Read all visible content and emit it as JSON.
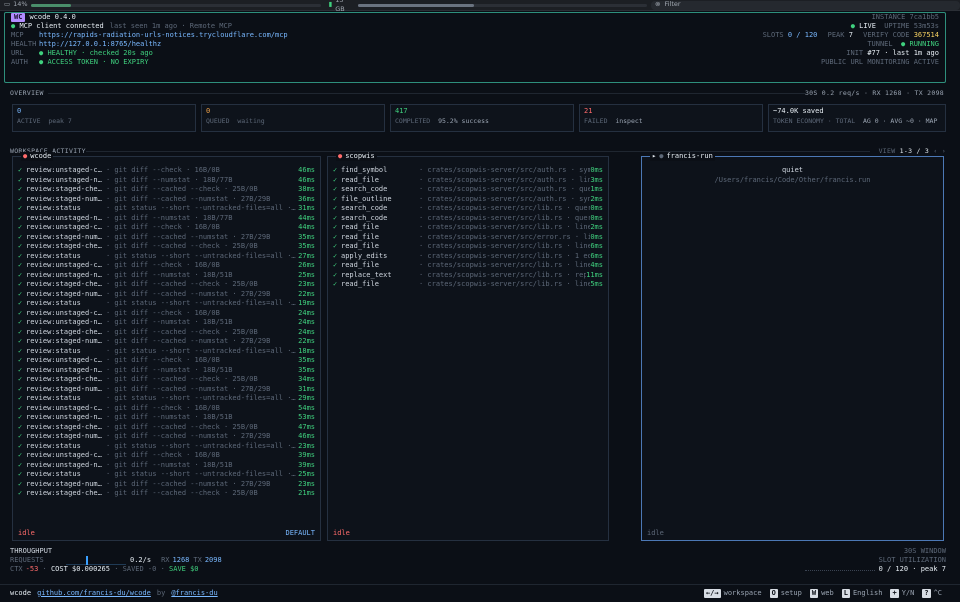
{
  "sysbar": {
    "cpu": "14%",
    "cpu_fraction": 0.14,
    "mem": "15 GB",
    "mem_fraction": 0.4,
    "filter_placeholder": "Filter"
  },
  "header": {
    "badge": "WC",
    "title": "wcode 0.4.0",
    "instance": "INSTANCE 7ca1bb5",
    "client_status": "MCP client connected",
    "last_seen": "last seen 1m ago · Remote MCP",
    "live": "LIVE",
    "uptime": "UPTIME 53m53s",
    "mcp_label": "MCP",
    "mcp_url": "https://rapids-radiation-urls-notices.trycloudflare.com/mcp",
    "slots_label": "SLOTS",
    "slots": "0 / 120",
    "peak_label": "PEAK",
    "peak": "7",
    "verify_label": "VERIFY CODE",
    "verify": "367514",
    "health_label": "HEALTH",
    "health_url": "http://127.0.0.1:8765/healthz",
    "tunnel_label": "TUNNEL",
    "tunnel_status": "RUNNING",
    "url_label": "URL",
    "url_status": "HEALTHY · checked 20s ago",
    "init_label": "INIT",
    "init": "#77 · last 1m ago",
    "auth_label": "AUTH",
    "auth_status": "ACCESS TOKEN · NO EXPIRY",
    "auth_right": "PUBLIC URL MONITORING ACTIVE"
  },
  "overview": {
    "label": "OVERVIEW",
    "right": "30S  0.2 req/s · RX 1268 · TX 2098",
    "cards": [
      {
        "value": "0",
        "sub_a": "ACTIVE",
        "sub_b": "peak 7"
      },
      {
        "value": "0",
        "sub_a": "QUEUED",
        "sub_b": "waiting"
      },
      {
        "value": "417",
        "sub_a": "COMPLETED",
        "sub_b": "95.2% success"
      },
      {
        "value": "21",
        "sub_a": "FAILED",
        "sub_b": "inspect"
      },
      {
        "value": "~74.0K saved",
        "sub_a": "TOKEN ECONOMY · TOTAL",
        "sub_b": "AG 0 · AVG ~0 · MAP"
      }
    ]
  },
  "workspace": {
    "label": "WORKSPACE ACTIVITY",
    "view_label": "VIEW",
    "view": "1-3 / 3",
    "panes": [
      {
        "title": "wcode",
        "foot_left": "idle",
        "foot_right": "DEFAULT",
        "rows": [
          {
            "name": "review:unstaged-c…",
            "desc": "· git diff --check · 16B/0B",
            "ms": "46ms"
          },
          {
            "name": "review:unstaged-n…",
            "desc": "· git diff --numstat · 18B/77B",
            "ms": "46ms"
          },
          {
            "name": "review:staged-che…",
            "desc": "· git diff --cached --check · 25B/0B",
            "ms": "38ms"
          },
          {
            "name": "review:staged-num…",
            "desc": "· git diff --cached --numstat · 27B/29B",
            "ms": "36ms"
          },
          {
            "name": "review:status",
            "desc": "· git status --short --untracked-files=all ·…",
            "ms": "31ms"
          },
          {
            "name": "review:unstaged-n…",
            "desc": "· git diff --numstat · 18B/77B",
            "ms": "44ms"
          },
          {
            "name": "review:unstaged-c…",
            "desc": "· git diff --check · 16B/0B",
            "ms": "44ms"
          },
          {
            "name": "review:staged-num…",
            "desc": "· git diff --cached --numstat · 27B/29B",
            "ms": "35ms"
          },
          {
            "name": "review:staged-che…",
            "desc": "· git diff --cached --check · 25B/0B",
            "ms": "35ms"
          },
          {
            "name": "review:status",
            "desc": "· git status --short --untracked-files=all ·…",
            "ms": "27ms"
          },
          {
            "name": "review:unstaged-c…",
            "desc": "· git diff --check · 16B/0B",
            "ms": "26ms"
          },
          {
            "name": "review:unstaged-n…",
            "desc": "· git diff --numstat · 18B/51B",
            "ms": "25ms"
          },
          {
            "name": "review:staged-che…",
            "desc": "· git diff --cached --check · 25B/0B",
            "ms": "23ms"
          },
          {
            "name": "review:staged-num…",
            "desc": "· git diff --cached --numstat · 27B/29B",
            "ms": "22ms"
          },
          {
            "name": "review:status",
            "desc": "· git status --short --untracked-files=all ·…",
            "ms": "19ms"
          },
          {
            "name": "review:unstaged-c…",
            "desc": "· git diff --check · 16B/0B",
            "ms": "24ms"
          },
          {
            "name": "review:unstaged-n…",
            "desc": "· git diff --numstat · 18B/51B",
            "ms": "24ms"
          },
          {
            "name": "review:staged-che…",
            "desc": "· git diff --cached --check · 25B/0B",
            "ms": "24ms"
          },
          {
            "name": "review:staged-num…",
            "desc": "· git diff --cached --numstat · 27B/29B",
            "ms": "22ms"
          },
          {
            "name": "review:status",
            "desc": "· git status --short --untracked-files=all ·…",
            "ms": "18ms"
          },
          {
            "name": "review:unstaged-c…",
            "desc": "· git diff --check · 16B/0B",
            "ms": "35ms"
          },
          {
            "name": "review:unstaged-n…",
            "desc": "· git diff --numstat · 18B/51B",
            "ms": "35ms"
          },
          {
            "name": "review:staged-che…",
            "desc": "· git diff --cached --check · 25B/0B",
            "ms": "34ms"
          },
          {
            "name": "review:staged-num…",
            "desc": "· git diff --cached --numstat · 27B/29B",
            "ms": "31ms"
          },
          {
            "name": "review:status",
            "desc": "· git status --short --untracked-files=all ·…",
            "ms": "29ms"
          },
          {
            "name": "review:unstaged-c…",
            "desc": "· git diff --check · 16B/0B",
            "ms": "54ms"
          },
          {
            "name": "review:unstaged-n…",
            "desc": "· git diff --numstat · 18B/51B",
            "ms": "53ms"
          },
          {
            "name": "review:staged-che…",
            "desc": "· git diff --cached --check · 25B/0B",
            "ms": "47ms"
          },
          {
            "name": "review:staged-num…",
            "desc": "· git diff --cached --numstat · 27B/29B",
            "ms": "46ms"
          },
          {
            "name": "review:status",
            "desc": "· git status --short --untracked-files=all ·…",
            "ms": "23ms"
          },
          {
            "name": "review:unstaged-c…",
            "desc": "· git diff --check · 16B/0B",
            "ms": "39ms"
          },
          {
            "name": "review:unstaged-n…",
            "desc": "· git diff --numstat · 18B/51B",
            "ms": "39ms"
          },
          {
            "name": "review:status",
            "desc": "· git status --short --untracked-files=all ·…",
            "ms": "25ms"
          },
          {
            "name": "review:staged-num…",
            "desc": "· git diff --cached --numstat · 27B/29B",
            "ms": "23ms"
          },
          {
            "name": "review:staged-che…",
            "desc": "· git diff --cached --check · 25B/0B",
            "ms": "21ms"
          }
        ]
      },
      {
        "title": "scopwis",
        "foot_left": "idle",
        "foot_right": "",
        "rows": [
          {
            "name": "find_symbol",
            "desc": "· crates/scopwis-server/src/auth.rs · symbol…",
            "ms": "0ms"
          },
          {
            "name": "read_file",
            "desc": "· crates/scopwis-server/src/auth.rs · lines …",
            "ms": "3ms"
          },
          {
            "name": "search_code",
            "desc": "· crates/scopwis-server/src/auth.rs · query …",
            "ms": "1ms"
          },
          {
            "name": "file_outline",
            "desc": "· crates/scopwis-server/src/auth.rs · syntax…",
            "ms": "2ms"
          },
          {
            "name": "search_code",
            "desc": "· crates/scopwis-server/src/lib.rs · query 4…",
            "ms": "0ms"
          },
          {
            "name": "search_code",
            "desc": "· crates/scopwis-server/src/lib.rs · query 4…",
            "ms": "0ms"
          },
          {
            "name": "read_file",
            "desc": "· crates/scopwis-server/src/lib.rs · lines 1…",
            "ms": "2ms"
          },
          {
            "name": "read_file",
            "desc": "· crates/scopwis-server/src/error.rs · lines…",
            "ms": "0ms"
          },
          {
            "name": "read_file",
            "desc": "· crates/scopwis-server/src/lib.rs · lines 5…",
            "ms": "6ms"
          },
          {
            "name": "apply_edits",
            "desc": "· crates/scopwis-server/src/lib.rs · 1 edits…",
            "ms": "6ms"
          },
          {
            "name": "read_file",
            "desc": "· crates/scopwis-server/src/lib.rs · lines 5…",
            "ms": "4ms"
          },
          {
            "name": "replace_text",
            "desc": "· crates/scopwis-server/src/lib.rs · replace…",
            "ms": "11ms"
          },
          {
            "name": "read_file",
            "desc": "· crates/scopwis-server/src/lib.rs · lines 5…",
            "ms": "5ms"
          }
        ]
      },
      {
        "title": "francis-run",
        "foot_left": "idle",
        "foot_right": "",
        "quiet": "quiet",
        "path": "/Users/francis/Code/Other/francis.run",
        "rows": []
      }
    ]
  },
  "throughput": {
    "label": "THROUGHPUT",
    "window": "30S WINDOW",
    "requests_label": "REQUESTS",
    "rate": "0.2/s",
    "rx_label": "RX",
    "rx": "1268",
    "tx_label": "TX",
    "tx": "2098",
    "slot_util": "SLOT UTILIZATION",
    "ctx_label": "CTX",
    "ctx": "-53",
    "cost": "COST $0.000265",
    "saved": "SAVED -0",
    "save": "SAVE $0",
    "slots": "0 / 120 · peak 7",
    "request_bars": [
      0,
      0,
      0,
      0,
      0,
      0,
      0,
      0,
      0,
      0,
      1,
      0,
      0,
      0,
      0,
      0,
      0,
      0,
      0,
      0,
      0,
      0,
      0,
      0,
      0,
      0,
      0,
      0,
      0,
      0
    ]
  },
  "footer": {
    "app": "wcode",
    "repo": "github.com/francis-du/wcode",
    "by": "by",
    "author": "@francis-du",
    "keys": [
      {
        "key": "←/→",
        "label": "workspace"
      },
      {
        "key": "O",
        "label": "setup"
      },
      {
        "key": "W",
        "label": "web"
      },
      {
        "key": "L",
        "label": "English"
      },
      {
        "key": "+",
        "label": "Y/N"
      },
      {
        "key": "?",
        "label": "^C"
      }
    ]
  },
  "colors": {
    "accent": "#2e8f7c",
    "green": "#3fd07e",
    "red": "#ff6b6b",
    "purple": "#b28cff",
    "blue": "#79b8ff"
  }
}
